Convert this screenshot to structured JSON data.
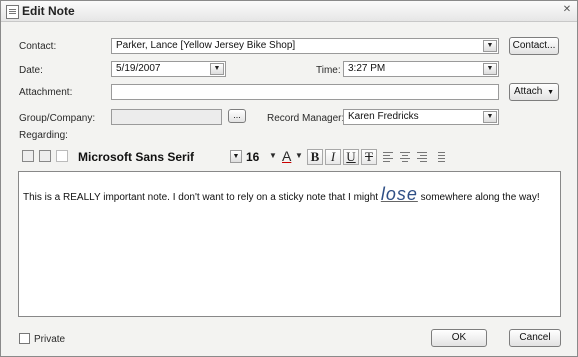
{
  "window": {
    "title": "Edit Note"
  },
  "form": {
    "contact_label": "Contact:",
    "contact_value": "Parker, Lance [Yellow Jersey Bike Shop]",
    "contact_button": "Contact...",
    "date_label": "Date:",
    "date_value": "5/19/2007",
    "time_label": "Time:",
    "time_value": "3:27 PM",
    "attachment_label": "Attachment:",
    "attachment_value": "",
    "attach_button": "Attach",
    "group_label": "Group/Company:",
    "group_value": "",
    "browse_button": "...",
    "record_manager_label": "Record Manager:",
    "record_manager_value": "Karen Fredricks",
    "regarding_label": "Regarding:"
  },
  "toolbar": {
    "font_name": "Microsoft Sans Serif",
    "font_size": "16",
    "font_color_glyph": "A",
    "bold": "B",
    "italic": "I",
    "underline": "U",
    "strike": "T"
  },
  "editor": {
    "text_before": "This is a REALLY important note.  I don't want to rely on a sticky note that I might ",
    "text_emphasis": "lose",
    "text_after": " somewhere along the way!"
  },
  "footer": {
    "private_label": "Private",
    "ok_label": "OK",
    "cancel_label": "Cancel"
  }
}
